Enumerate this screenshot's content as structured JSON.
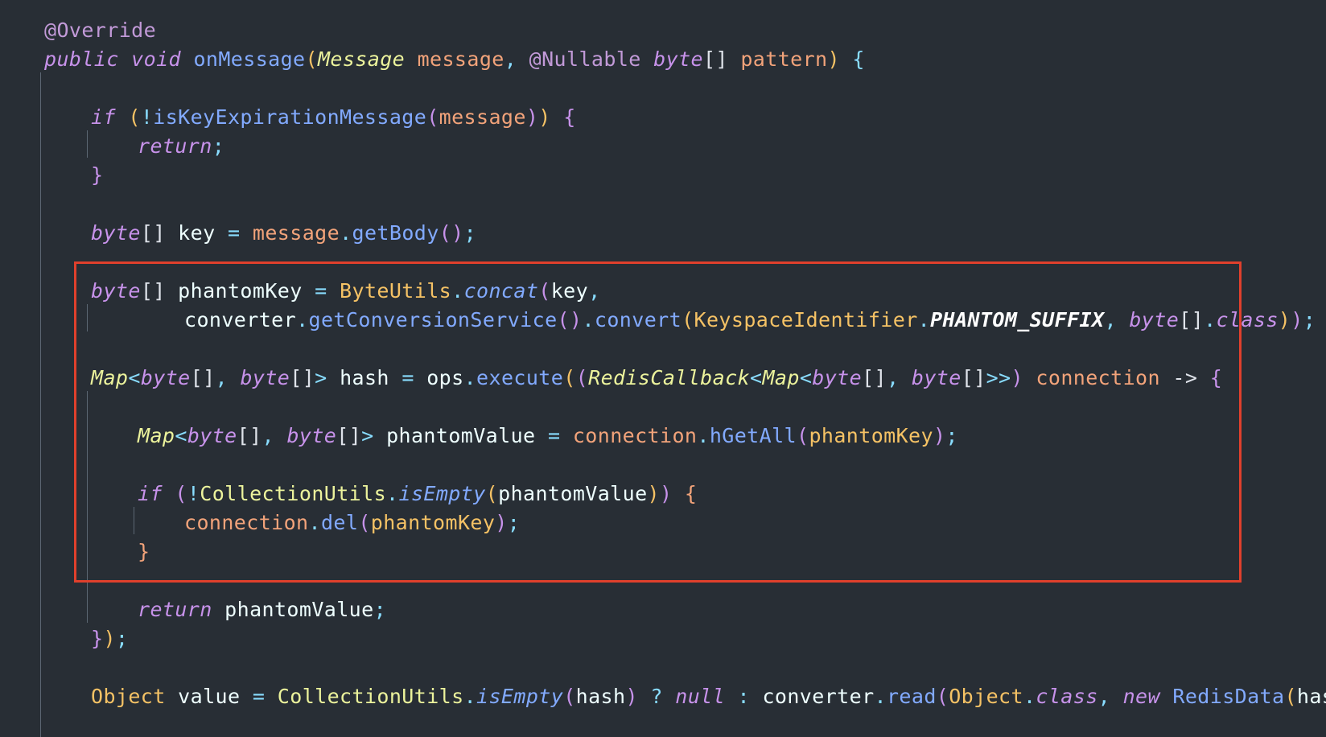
{
  "editor": {
    "lines": [
      {
        "indent": 0,
        "tokens": [
          {
            "t": "@Override",
            "c": "#c29ad8"
          }
        ]
      },
      {
        "indent": 0,
        "tokens": [
          {
            "t": "public",
            "c": "#c792ea",
            "i": true
          },
          {
            "t": " "
          },
          {
            "t": "void",
            "c": "#c792ea",
            "i": true
          },
          {
            "t": " "
          },
          {
            "t": "onMessage",
            "c": "#82aaff"
          },
          {
            "t": "(",
            "c": "#f5c265"
          },
          {
            "t": "Message",
            "c": "#ecf39c",
            "i": true
          },
          {
            "t": " "
          },
          {
            "t": "message",
            "c": "#f2a37a"
          },
          {
            "t": ", ",
            "c": "#89ddff"
          },
          {
            "t": "@Nullable",
            "c": "#c29ad8"
          },
          {
            "t": " "
          },
          {
            "t": "byte",
            "c": "#c792ea",
            "i": true
          },
          {
            "t": "[]",
            "c": "#dfe3ea"
          },
          {
            "t": " "
          },
          {
            "t": "pattern",
            "c": "#f2a37a"
          },
          {
            "t": ")",
            "c": "#f5c265"
          },
          {
            "t": " "
          },
          {
            "t": "{",
            "c": "#89ddff"
          }
        ]
      },
      {
        "indent": 0,
        "tokens": []
      },
      {
        "indent": 2,
        "tokens": [
          {
            "t": "if",
            "c": "#c792ea",
            "i": true
          },
          {
            "t": " "
          },
          {
            "t": "(",
            "c": "#f5c265"
          },
          {
            "t": "!",
            "c": "#89ddff"
          },
          {
            "t": "isKeyExpirationMessage",
            "c": "#82aaff"
          },
          {
            "t": "(",
            "c": "#c792ea"
          },
          {
            "t": "message",
            "c": "#f2a37a"
          },
          {
            "t": ")",
            "c": "#c792ea"
          },
          {
            "t": ")",
            "c": "#f5c265"
          },
          {
            "t": " "
          },
          {
            "t": "{",
            "c": "#c792ea"
          }
        ]
      },
      {
        "indent": 4,
        "tokens": [
          {
            "t": "return",
            "c": "#c792ea",
            "i": true
          },
          {
            "t": ";",
            "c": "#89ddff"
          }
        ]
      },
      {
        "indent": 2,
        "tokens": [
          {
            "t": "}",
            "c": "#c792ea"
          }
        ]
      },
      {
        "indent": 0,
        "tokens": []
      },
      {
        "indent": 2,
        "tokens": [
          {
            "t": "byte",
            "c": "#c792ea",
            "i": true
          },
          {
            "t": "[]",
            "c": "#dfe3ea"
          },
          {
            "t": " "
          },
          {
            "t": "key",
            "c": "#eeffff"
          },
          {
            "t": " "
          },
          {
            "t": "=",
            "c": "#89ddff"
          },
          {
            "t": " "
          },
          {
            "t": "message",
            "c": "#f2a37a"
          },
          {
            "t": ".",
            "c": "#89ddff"
          },
          {
            "t": "getBody",
            "c": "#82aaff"
          },
          {
            "t": "()",
            "c": "#c792ea"
          },
          {
            "t": ";",
            "c": "#89ddff"
          }
        ]
      },
      {
        "indent": 0,
        "tokens": []
      },
      {
        "indent": 2,
        "tokens": [
          {
            "t": "byte",
            "c": "#c792ea",
            "i": true
          },
          {
            "t": "[]",
            "c": "#dfe3ea"
          },
          {
            "t": " "
          },
          {
            "t": "phantomKey",
            "c": "#eeffff"
          },
          {
            "t": " "
          },
          {
            "t": "=",
            "c": "#89ddff"
          },
          {
            "t": " "
          },
          {
            "t": "ByteUtils",
            "c": "#f5c265"
          },
          {
            "t": ".",
            "c": "#89ddff"
          },
          {
            "t": "concat",
            "c": "#82aaff",
            "i": true
          },
          {
            "t": "(",
            "c": "#c792ea"
          },
          {
            "t": "key",
            "c": "#eeffff"
          },
          {
            "t": ",",
            "c": "#89ddff"
          }
        ]
      },
      {
        "indent": 6,
        "tokens": [
          {
            "t": "converter",
            "c": "#eeffff"
          },
          {
            "t": ".",
            "c": "#89ddff"
          },
          {
            "t": "getConversionService",
            "c": "#82aaff"
          },
          {
            "t": "()",
            "c": "#c792ea"
          },
          {
            "t": ".",
            "c": "#89ddff"
          },
          {
            "t": "convert",
            "c": "#82aaff"
          },
          {
            "t": "(",
            "c": "#f5c265"
          },
          {
            "t": "KeyspaceIdentifier",
            "c": "#f5c265"
          },
          {
            "t": ".",
            "c": "#89ddff"
          },
          {
            "t": "PHANTOM_SUFFIX",
            "c": "#ffffff",
            "i": true,
            "b": true
          },
          {
            "t": ",",
            "c": "#89ddff"
          },
          {
            "t": " "
          },
          {
            "t": "byte",
            "c": "#c792ea",
            "i": true
          },
          {
            "t": "[]",
            "c": "#dfe3ea"
          },
          {
            "t": ".",
            "c": "#89ddff"
          },
          {
            "t": "class",
            "c": "#c792ea",
            "i": true
          },
          {
            "t": ")",
            "c": "#f5c265"
          },
          {
            "t": ")",
            "c": "#c792ea"
          },
          {
            "t": ";",
            "c": "#89ddff"
          }
        ]
      },
      {
        "indent": 0,
        "tokens": []
      },
      {
        "indent": 2,
        "tokens": [
          {
            "t": "Map",
            "c": "#ecf39c",
            "i": true
          },
          {
            "t": "<",
            "c": "#89ddff"
          },
          {
            "t": "byte",
            "c": "#c792ea",
            "i": true
          },
          {
            "t": "[]",
            "c": "#dfe3ea"
          },
          {
            "t": ", ",
            "c": "#89ddff"
          },
          {
            "t": "byte",
            "c": "#c792ea",
            "i": true
          },
          {
            "t": "[]",
            "c": "#dfe3ea"
          },
          {
            "t": ">",
            "c": "#89ddff"
          },
          {
            "t": " "
          },
          {
            "t": "hash",
            "c": "#eeffff"
          },
          {
            "t": " "
          },
          {
            "t": "=",
            "c": "#89ddff"
          },
          {
            "t": " "
          },
          {
            "t": "ops",
            "c": "#eeffff"
          },
          {
            "t": ".",
            "c": "#89ddff"
          },
          {
            "t": "execute",
            "c": "#82aaff"
          },
          {
            "t": "(",
            "c": "#f5c265"
          },
          {
            "t": "(",
            "c": "#c792ea"
          },
          {
            "t": "RedisCallback",
            "c": "#ecf39c",
            "i": true
          },
          {
            "t": "<",
            "c": "#89ddff"
          },
          {
            "t": "Map",
            "c": "#ecf39c",
            "i": true
          },
          {
            "t": "<",
            "c": "#89ddff"
          },
          {
            "t": "byte",
            "c": "#c792ea",
            "i": true
          },
          {
            "t": "[]",
            "c": "#dfe3ea"
          },
          {
            "t": ", ",
            "c": "#89ddff"
          },
          {
            "t": "byte",
            "c": "#c792ea",
            "i": true
          },
          {
            "t": "[]",
            "c": "#dfe3ea"
          },
          {
            "t": ">>",
            "c": "#89ddff"
          },
          {
            "t": ")",
            "c": "#c792ea"
          },
          {
            "t": " "
          },
          {
            "t": "connection",
            "c": "#f2a37a"
          },
          {
            "t": " "
          },
          {
            "t": "->",
            "c": "#dfe3ea"
          },
          {
            "t": " "
          },
          {
            "t": "{",
            "c": "#c792ea"
          }
        ]
      },
      {
        "indent": 0,
        "tokens": []
      },
      {
        "indent": 4,
        "tokens": [
          {
            "t": "Map",
            "c": "#ecf39c",
            "i": true
          },
          {
            "t": "<",
            "c": "#89ddff"
          },
          {
            "t": "byte",
            "c": "#c792ea",
            "i": true
          },
          {
            "t": "[]",
            "c": "#dfe3ea"
          },
          {
            "t": ", ",
            "c": "#89ddff"
          },
          {
            "t": "byte",
            "c": "#c792ea",
            "i": true
          },
          {
            "t": "[]",
            "c": "#dfe3ea"
          },
          {
            "t": ">",
            "c": "#89ddff"
          },
          {
            "t": " "
          },
          {
            "t": "phantomValue",
            "c": "#eeffff"
          },
          {
            "t": " "
          },
          {
            "t": "=",
            "c": "#89ddff"
          },
          {
            "t": " "
          },
          {
            "t": "connection",
            "c": "#f2a37a"
          },
          {
            "t": ".",
            "c": "#89ddff"
          },
          {
            "t": "hGetAll",
            "c": "#82aaff"
          },
          {
            "t": "(",
            "c": "#c792ea"
          },
          {
            "t": "phantomKey",
            "c": "#f5c265"
          },
          {
            "t": ")",
            "c": "#c792ea"
          },
          {
            "t": ";",
            "c": "#89ddff"
          }
        ]
      },
      {
        "indent": 0,
        "tokens": []
      },
      {
        "indent": 4,
        "tokens": [
          {
            "t": "if",
            "c": "#c792ea",
            "i": true
          },
          {
            "t": " "
          },
          {
            "t": "(",
            "c": "#c792ea"
          },
          {
            "t": "!",
            "c": "#89ddff"
          },
          {
            "t": "CollectionUtils",
            "c": "#ecf39c"
          },
          {
            "t": ".",
            "c": "#89ddff"
          },
          {
            "t": "isEmpty",
            "c": "#82aaff",
            "i": true
          },
          {
            "t": "(",
            "c": "#f5c265"
          },
          {
            "t": "phantomValue",
            "c": "#eeffff"
          },
          {
            "t": ")",
            "c": "#f5c265"
          },
          {
            "t": ")",
            "c": "#c792ea"
          },
          {
            "t": " "
          },
          {
            "t": "{",
            "c": "#f2a37a"
          }
        ]
      },
      {
        "indent": 6,
        "tokens": [
          {
            "t": "connection",
            "c": "#f2a37a"
          },
          {
            "t": ".",
            "c": "#89ddff"
          },
          {
            "t": "del",
            "c": "#82aaff"
          },
          {
            "t": "(",
            "c": "#c792ea"
          },
          {
            "t": "phantomKey",
            "c": "#f5c265"
          },
          {
            "t": ")",
            "c": "#c792ea"
          },
          {
            "t": ";",
            "c": "#89ddff"
          }
        ]
      },
      {
        "indent": 4,
        "tokens": [
          {
            "t": "}",
            "c": "#f2a37a"
          }
        ]
      },
      {
        "indent": 0,
        "tokens": []
      },
      {
        "indent": 4,
        "tokens": [
          {
            "t": "return",
            "c": "#c792ea",
            "i": true
          },
          {
            "t": " "
          },
          {
            "t": "phantomValue",
            "c": "#eeffff"
          },
          {
            "t": ";",
            "c": "#89ddff"
          }
        ]
      },
      {
        "indent": 2,
        "tokens": [
          {
            "t": "}",
            "c": "#c792ea"
          },
          {
            "t": ")",
            "c": "#f5c265"
          },
          {
            "t": ";",
            "c": "#89ddff"
          }
        ]
      },
      {
        "indent": 0,
        "tokens": []
      },
      {
        "indent": 2,
        "tokens": [
          {
            "t": "Object",
            "c": "#f5c265"
          },
          {
            "t": " "
          },
          {
            "t": "value",
            "c": "#eeffff"
          },
          {
            "t": " "
          },
          {
            "t": "=",
            "c": "#89ddff"
          },
          {
            "t": " "
          },
          {
            "t": "CollectionUtils",
            "c": "#ecf39c"
          },
          {
            "t": ".",
            "c": "#89ddff"
          },
          {
            "t": "isEmpty",
            "c": "#82aaff",
            "i": true
          },
          {
            "t": "(",
            "c": "#c792ea"
          },
          {
            "t": "hash",
            "c": "#eeffff"
          },
          {
            "t": ")",
            "c": "#c792ea"
          },
          {
            "t": " "
          },
          {
            "t": "?",
            "c": "#89ddff"
          },
          {
            "t": " "
          },
          {
            "t": "null",
            "c": "#c792ea",
            "i": true
          },
          {
            "t": " "
          },
          {
            "t": ":",
            "c": "#89ddff"
          },
          {
            "t": " "
          },
          {
            "t": "converter",
            "c": "#eeffff"
          },
          {
            "t": ".",
            "c": "#89ddff"
          },
          {
            "t": "read",
            "c": "#82aaff"
          },
          {
            "t": "(",
            "c": "#c792ea"
          },
          {
            "t": "Object",
            "c": "#f5c265"
          },
          {
            "t": ".",
            "c": "#89ddff"
          },
          {
            "t": "class",
            "c": "#c792ea",
            "i": true
          },
          {
            "t": ",",
            "c": "#89ddff"
          },
          {
            "t": " "
          },
          {
            "t": "new",
            "c": "#c792ea",
            "i": true
          },
          {
            "t": " "
          },
          {
            "t": "RedisData",
            "c": "#82aaff"
          },
          {
            "t": "(",
            "c": "#f5c265"
          },
          {
            "t": "hash",
            "c": "#eeffff"
          },
          {
            "t": ")",
            "c": "#f5c265"
          },
          {
            "t": ")",
            "c": "#c792ea"
          },
          {
            "t": ";",
            "c": "#89ddff"
          }
        ]
      }
    ]
  },
  "colors": {
    "background": "#282e35",
    "highlight_border": "#e0402c",
    "indent_guide": "#5c6773"
  }
}
